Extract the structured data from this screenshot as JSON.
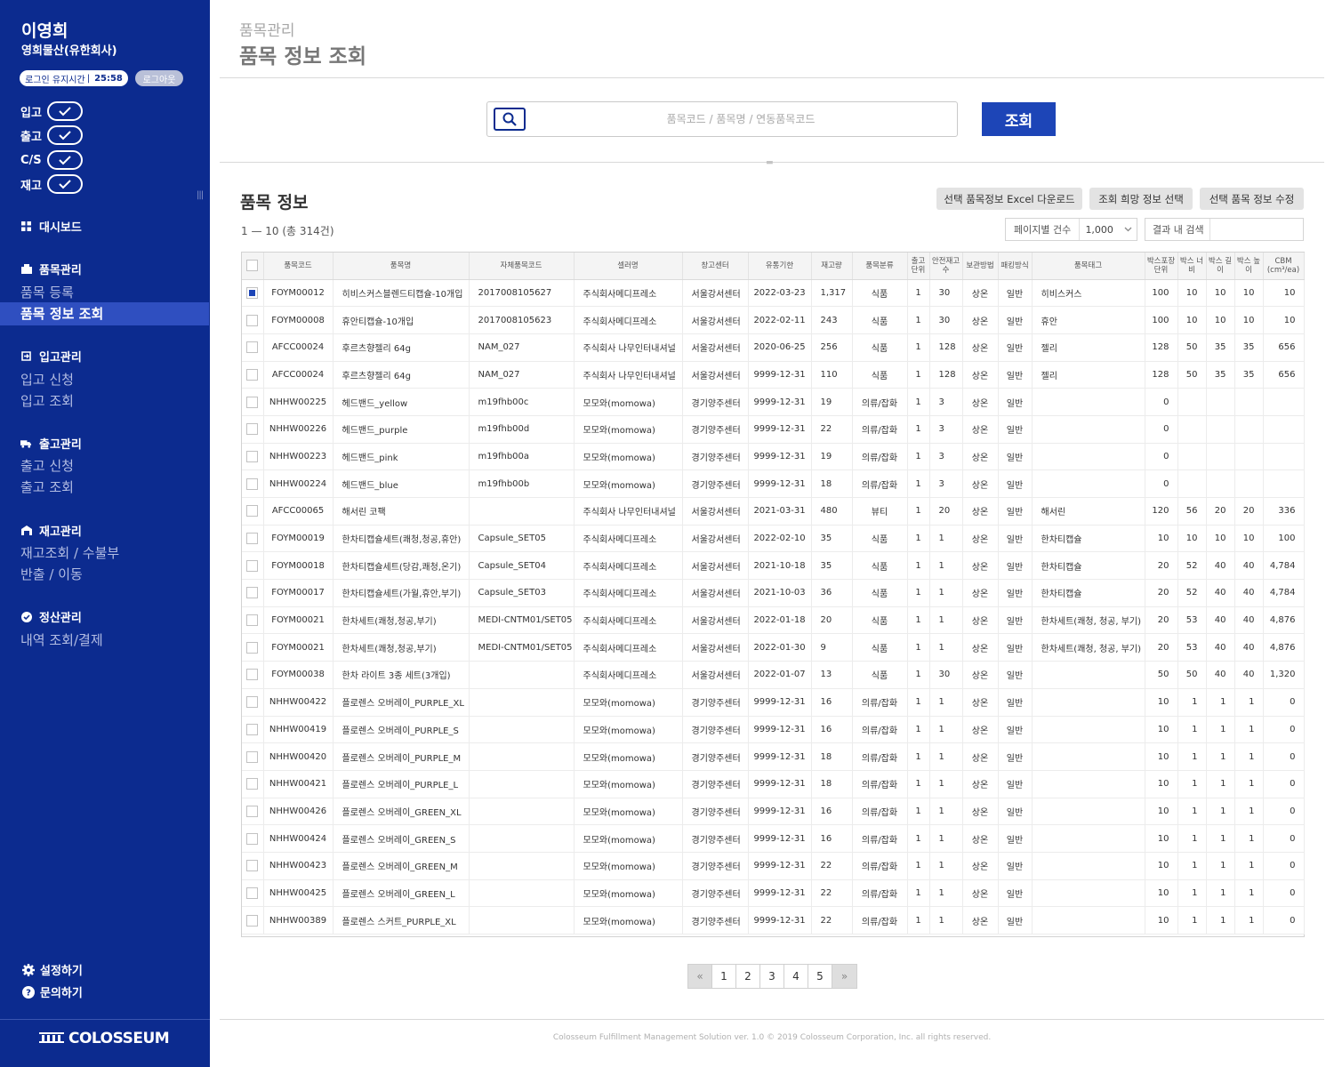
{
  "user": {
    "name": "이영희",
    "company": "영희물산(유한회사)"
  },
  "session": {
    "label": "로그인 유지시간",
    "time": "25:58",
    "logout_label": "로그아웃"
  },
  "status": [
    {
      "label": "입고"
    },
    {
      "label": "출고"
    },
    {
      "label": "C/S"
    },
    {
      "label": "재고"
    }
  ],
  "nav": {
    "dashboard": "대시보드",
    "items_header": "품목관리",
    "item_register": "품목 등록",
    "item_search": "품목 정보 조회",
    "inbound_header": "입고관리",
    "inbound_apply": "입고 신청",
    "inbound_search": "입고 조회",
    "outbound_header": "출고관리",
    "outbound_apply": "출고 신청",
    "outbound_search": "출고 조회",
    "stock_header": "재고관리",
    "stock_search": "재고조회 / 수불부",
    "stock_move": "반출 / 이동",
    "settle_header": "정산관리",
    "settle_history": "내역 조회/결제"
  },
  "bottom_links": {
    "settings": "설정하기",
    "inquiry": "문의하기"
  },
  "brand": "COLOSSEUM",
  "header": {
    "breadcrumb": "품목관리",
    "title": "품목 정보 조회"
  },
  "search": {
    "placeholder": "품목코드 / 품목명 / 연동품목코드",
    "button": "조회"
  },
  "section": {
    "title": "품목 정보",
    "count": "1 — 10 (총 314건)"
  },
  "actions": {
    "excel": "선택 품목정보 Excel 다운로드",
    "select_info": "조회 희망 정보 선택",
    "edit": "선택 품목 정보 수정"
  },
  "per_page": {
    "label": "페이지별 건수",
    "value": "1,000"
  },
  "filter": {
    "label": "결과 내 검색"
  },
  "table": {
    "columns": [
      "품목코드",
      "품목명",
      "자체품목코드",
      "셀러명",
      "창고센터",
      "유통기한",
      "재고량",
      "품목분류",
      "출고 단위",
      "안전재고수",
      "보관방법",
      "패킹방식",
      "품목태그",
      "박스포장 단위",
      "박스 너비",
      "박스 길이",
      "박스 높이",
      "CBM (cm³/ea)"
    ],
    "rows": [
      {
        "checked": true,
        "code": "FOYM00012",
        "name": "히비스커스블렌드티캡슐-10개입",
        "own": "2017008105627",
        "seller": "주식회사메디프레소",
        "center": "서울강서센터",
        "exp": "2022-03-23",
        "stock": "1,317",
        "cat": "식품",
        "unit": "1",
        "safe": "30",
        "store": "상온",
        "pack": "일반",
        "tag": "히비스커스",
        "bu": "100",
        "bw": "10",
        "bl": "10",
        "bh": "10",
        "cbm": "10"
      },
      {
        "checked": false,
        "code": "FOYM00008",
        "name": "휴안티캡슐-10개입",
        "own": "2017008105623",
        "seller": "주식회사메디프레소",
        "center": "서울강서센터",
        "exp": "2022-02-11",
        "stock": "243",
        "cat": "식품",
        "unit": "1",
        "safe": "30",
        "store": "상온",
        "pack": "일반",
        "tag": "휴안",
        "bu": "100",
        "bw": "10",
        "bl": "10",
        "bh": "10",
        "cbm": "10"
      },
      {
        "checked": false,
        "code": "AFCC00024",
        "name": "후르츠향젤리 64g",
        "own": "NAM_027",
        "seller": "주식회사 나무인터내셔널",
        "center": "서울강서센터",
        "exp": "2020-06-25",
        "stock": "256",
        "cat": "식품",
        "unit": "1",
        "safe": "128",
        "store": "상온",
        "pack": "일반",
        "tag": "젤리",
        "bu": "128",
        "bw": "50",
        "bl": "35",
        "bh": "35",
        "cbm": "656"
      },
      {
        "checked": false,
        "code": "AFCC00024",
        "name": "후르츠향젤리 64g",
        "own": "NAM_027",
        "seller": "주식회사 나무인터내셔널",
        "center": "서울강서센터",
        "exp": "9999-12-31",
        "stock": "110",
        "cat": "식품",
        "unit": "1",
        "safe": "128",
        "store": "상온",
        "pack": "일반",
        "tag": "젤리",
        "bu": "128",
        "bw": "50",
        "bl": "35",
        "bh": "35",
        "cbm": "656"
      },
      {
        "checked": false,
        "code": "NHHW00225",
        "name": "헤드밴드_yellow",
        "own": "m19fhb00c",
        "seller": "모모와(momowa)",
        "center": "경기양주센터",
        "exp": "9999-12-31",
        "stock": "19",
        "cat": "의류/잡화",
        "unit": "1",
        "safe": "3",
        "store": "상온",
        "pack": "일반",
        "tag": "",
        "bu": "0",
        "bw": "",
        "bl": "",
        "bh": "",
        "cbm": ""
      },
      {
        "checked": false,
        "code": "NHHW00226",
        "name": "헤드밴드_purple",
        "own": "m19fhb00d",
        "seller": "모모와(momowa)",
        "center": "경기양주센터",
        "exp": "9999-12-31",
        "stock": "22",
        "cat": "의류/잡화",
        "unit": "1",
        "safe": "3",
        "store": "상온",
        "pack": "일반",
        "tag": "",
        "bu": "0",
        "bw": "",
        "bl": "",
        "bh": "",
        "cbm": ""
      },
      {
        "checked": false,
        "code": "NHHW00223",
        "name": "헤드밴드_pink",
        "own": "m19fhb00a",
        "seller": "모모와(momowa)",
        "center": "경기양주센터",
        "exp": "9999-12-31",
        "stock": "19",
        "cat": "의류/잡화",
        "unit": "1",
        "safe": "3",
        "store": "상온",
        "pack": "일반",
        "tag": "",
        "bu": "0",
        "bw": "",
        "bl": "",
        "bh": "",
        "cbm": ""
      },
      {
        "checked": false,
        "code": "NHHW00224",
        "name": "헤드밴드_blue",
        "own": "m19fhb00b",
        "seller": "모모와(momowa)",
        "center": "경기양주센터",
        "exp": "9999-12-31",
        "stock": "18",
        "cat": "의류/잡화",
        "unit": "1",
        "safe": "3",
        "store": "상온",
        "pack": "일반",
        "tag": "",
        "bu": "0",
        "bw": "",
        "bl": "",
        "bh": "",
        "cbm": ""
      },
      {
        "checked": false,
        "code": "AFCC00065",
        "name": "해서린 코팩",
        "own": "",
        "seller": "주식회사 나무인터내셔널",
        "center": "서울강서센터",
        "exp": "2021-03-31",
        "stock": "480",
        "cat": "뷰티",
        "unit": "1",
        "safe": "20",
        "store": "상온",
        "pack": "일반",
        "tag": "해서린",
        "bu": "120",
        "bw": "56",
        "bl": "20",
        "bh": "20",
        "cbm": "336"
      },
      {
        "checked": false,
        "code": "FOYM00019",
        "name": "한차티캡슐세트(쾌청,청공,휴안)",
        "own": "Capsule_SET05",
        "seller": "주식회사메디프레소",
        "center": "서울강서센터",
        "exp": "2022-02-10",
        "stock": "35",
        "cat": "식품",
        "unit": "1",
        "safe": "1",
        "store": "상온",
        "pack": "일반",
        "tag": "한차티캡슐",
        "bu": "10",
        "bw": "10",
        "bl": "10",
        "bh": "10",
        "cbm": "100"
      },
      {
        "checked": false,
        "code": "FOYM00018",
        "name": "한차티캡슐세트(당감,쾌청,온기)",
        "own": "Capsule_SET04",
        "seller": "주식회사메디프레소",
        "center": "서울강서센터",
        "exp": "2021-10-18",
        "stock": "35",
        "cat": "식품",
        "unit": "1",
        "safe": "1",
        "store": "상온",
        "pack": "일반",
        "tag": "한차티캡슐",
        "bu": "20",
        "bw": "52",
        "bl": "40",
        "bh": "40",
        "cbm": "4,784"
      },
      {
        "checked": false,
        "code": "FOYM00017",
        "name": "한차티캡슐세트(가월,휴안,부기)",
        "own": "Capsule_SET03",
        "seller": "주식회사메디프레소",
        "center": "서울강서센터",
        "exp": "2021-10-03",
        "stock": "36",
        "cat": "식품",
        "unit": "1",
        "safe": "1",
        "store": "상온",
        "pack": "일반",
        "tag": "한차티캡슐",
        "bu": "20",
        "bw": "52",
        "bl": "40",
        "bh": "40",
        "cbm": "4,784"
      },
      {
        "checked": false,
        "code": "FOYM00021",
        "name": "한차세트(쾌청,청공,부기)",
        "own": "MEDI-CNTM01/SET05",
        "seller": "주식회사메디프레소",
        "center": "서울강서센터",
        "exp": "2022-01-18",
        "stock": "20",
        "cat": "식품",
        "unit": "1",
        "safe": "1",
        "store": "상온",
        "pack": "일반",
        "tag": "한차세트(쾌청, 청공, 부기)",
        "bu": "20",
        "bw": "53",
        "bl": "40",
        "bh": "40",
        "cbm": "4,876"
      },
      {
        "checked": false,
        "code": "FOYM00021",
        "name": "한차세트(쾌청,청공,부기)",
        "own": "MEDI-CNTM01/SET05",
        "seller": "주식회사메디프레소",
        "center": "서울강서센터",
        "exp": "2022-01-30",
        "stock": "9",
        "cat": "식품",
        "unit": "1",
        "safe": "1",
        "store": "상온",
        "pack": "일반",
        "tag": "한차세트(쾌청, 청공, 부기)",
        "bu": "20",
        "bw": "53",
        "bl": "40",
        "bh": "40",
        "cbm": "4,876"
      },
      {
        "checked": false,
        "code": "FOYM00038",
        "name": "한차 라이트 3종 세트(3개입)",
        "own": "",
        "seller": "주식회사메디프레소",
        "center": "서울강서센터",
        "exp": "2022-01-07",
        "stock": "13",
        "cat": "식품",
        "unit": "1",
        "safe": "30",
        "store": "상온",
        "pack": "일반",
        "tag": "",
        "bu": "50",
        "bw": "50",
        "bl": "40",
        "bh": "40",
        "cbm": "1,320"
      },
      {
        "checked": false,
        "code": "NHHW00422",
        "name": "플로렌스 오버레이_PURPLE_XL",
        "own": "",
        "seller": "모모와(momowa)",
        "center": "경기양주센터",
        "exp": "9999-12-31",
        "stock": "16",
        "cat": "의류/잡화",
        "unit": "1",
        "safe": "1",
        "store": "상온",
        "pack": "일반",
        "tag": "",
        "bu": "10",
        "bw": "1",
        "bl": "1",
        "bh": "1",
        "cbm": "0"
      },
      {
        "checked": false,
        "code": "NHHW00419",
        "name": "플로렌스 오버레이_PURPLE_S",
        "own": "",
        "seller": "모모와(momowa)",
        "center": "경기양주센터",
        "exp": "9999-12-31",
        "stock": "16",
        "cat": "의류/잡화",
        "unit": "1",
        "safe": "1",
        "store": "상온",
        "pack": "일반",
        "tag": "",
        "bu": "10",
        "bw": "1",
        "bl": "1",
        "bh": "1",
        "cbm": "0"
      },
      {
        "checked": false,
        "code": "NHHW00420",
        "name": "플로렌스 오버레이_PURPLE_M",
        "own": "",
        "seller": "모모와(momowa)",
        "center": "경기양주센터",
        "exp": "9999-12-31",
        "stock": "18",
        "cat": "의류/잡화",
        "unit": "1",
        "safe": "1",
        "store": "상온",
        "pack": "일반",
        "tag": "",
        "bu": "10",
        "bw": "1",
        "bl": "1",
        "bh": "1",
        "cbm": "0"
      },
      {
        "checked": false,
        "code": "NHHW00421",
        "name": "플로렌스 오버레이_PURPLE_L",
        "own": "",
        "seller": "모모와(momowa)",
        "center": "경기양주센터",
        "exp": "9999-12-31",
        "stock": "18",
        "cat": "의류/잡화",
        "unit": "1",
        "safe": "1",
        "store": "상온",
        "pack": "일반",
        "tag": "",
        "bu": "10",
        "bw": "1",
        "bl": "1",
        "bh": "1",
        "cbm": "0"
      },
      {
        "checked": false,
        "code": "NHHW00426",
        "name": "플로렌스 오버레이_GREEN_XL",
        "own": "",
        "seller": "모모와(momowa)",
        "center": "경기양주센터",
        "exp": "9999-12-31",
        "stock": "16",
        "cat": "의류/잡화",
        "unit": "1",
        "safe": "1",
        "store": "상온",
        "pack": "일반",
        "tag": "",
        "bu": "10",
        "bw": "1",
        "bl": "1",
        "bh": "1",
        "cbm": "0"
      },
      {
        "checked": false,
        "code": "NHHW00424",
        "name": "플로렌스 오버레이_GREEN_S",
        "own": "",
        "seller": "모모와(momowa)",
        "center": "경기양주센터",
        "exp": "9999-12-31",
        "stock": "16",
        "cat": "의류/잡화",
        "unit": "1",
        "safe": "1",
        "store": "상온",
        "pack": "일반",
        "tag": "",
        "bu": "10",
        "bw": "1",
        "bl": "1",
        "bh": "1",
        "cbm": "0"
      },
      {
        "checked": false,
        "code": "NHHW00423",
        "name": "플로렌스 오버레이_GREEN_M",
        "own": "",
        "seller": "모모와(momowa)",
        "center": "경기양주센터",
        "exp": "9999-12-31",
        "stock": "22",
        "cat": "의류/잡화",
        "unit": "1",
        "safe": "1",
        "store": "상온",
        "pack": "일반",
        "tag": "",
        "bu": "10",
        "bw": "1",
        "bl": "1",
        "bh": "1",
        "cbm": "0"
      },
      {
        "checked": false,
        "code": "NHHW00425",
        "name": "플로렌스 오버레이_GREEN_L",
        "own": "",
        "seller": "모모와(momowa)",
        "center": "경기양주센터",
        "exp": "9999-12-31",
        "stock": "22",
        "cat": "의류/잡화",
        "unit": "1",
        "safe": "1",
        "store": "상온",
        "pack": "일반",
        "tag": "",
        "bu": "10",
        "bw": "1",
        "bl": "1",
        "bh": "1",
        "cbm": "0"
      },
      {
        "checked": false,
        "code": "NHHW00389",
        "name": "플로렌스 스커트_PURPLE_XL",
        "own": "",
        "seller": "모모와(momowa)",
        "center": "경기양주센터",
        "exp": "9999-12-31",
        "stock": "22",
        "cat": "의류/잡화",
        "unit": "1",
        "safe": "1",
        "store": "상온",
        "pack": "일반",
        "tag": "",
        "bu": "10",
        "bw": "1",
        "bl": "1",
        "bh": "1",
        "cbm": "0"
      }
    ]
  },
  "pagination": {
    "prev": "«",
    "pages": [
      "1",
      "2",
      "3",
      "4",
      "5"
    ],
    "next": "»"
  },
  "footer": "Colosseum Fulfillment Management Solution ver. 1.0   © 2019 Colosseum Corporation, Inc. all rights reserved.",
  "colors": {
    "sidebar": "#0c2b8f",
    "accent": "#1d45b7",
    "active_nav": "#2f4fc0"
  },
  "icons": [
    "search-icon",
    "check-icon",
    "dashboard-icon",
    "box-icon",
    "inbound-icon",
    "truck-icon",
    "warehouse-icon",
    "check-circle-icon",
    "gear-icon",
    "question-icon",
    "chevron-down-icon",
    "brand-logo-icon"
  ]
}
